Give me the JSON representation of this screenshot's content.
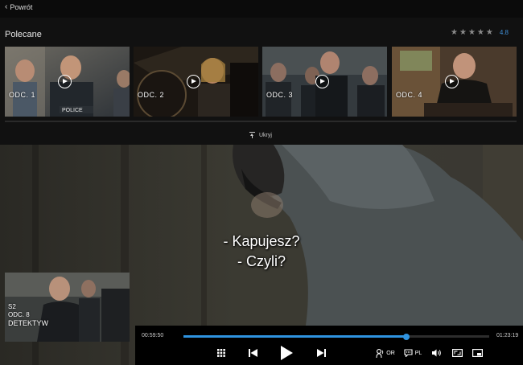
{
  "header": {
    "back_label": "Powrót"
  },
  "recommended": {
    "title": "Polecane",
    "rating": {
      "stars": 5,
      "value": "4.8"
    },
    "episodes": [
      {
        "label": "ODC. 1"
      },
      {
        "label": "ODC. 2"
      },
      {
        "label": "ODC. 3"
      },
      {
        "label": "ODC. 4"
      }
    ],
    "hide_label": "Ukryj"
  },
  "player": {
    "subtitles": [
      "- Kapujesz?",
      "- Czyli?"
    ],
    "next_episode": {
      "season": "S2",
      "episode": "ODC. 8",
      "title": "DETEKTYW"
    },
    "current_time": "00:59:50",
    "total_time": "01:23:19",
    "progress": 0.73,
    "audio_label": "OR",
    "subtitles_label": "PL"
  },
  "colors": {
    "accent": "#2f93e0"
  }
}
